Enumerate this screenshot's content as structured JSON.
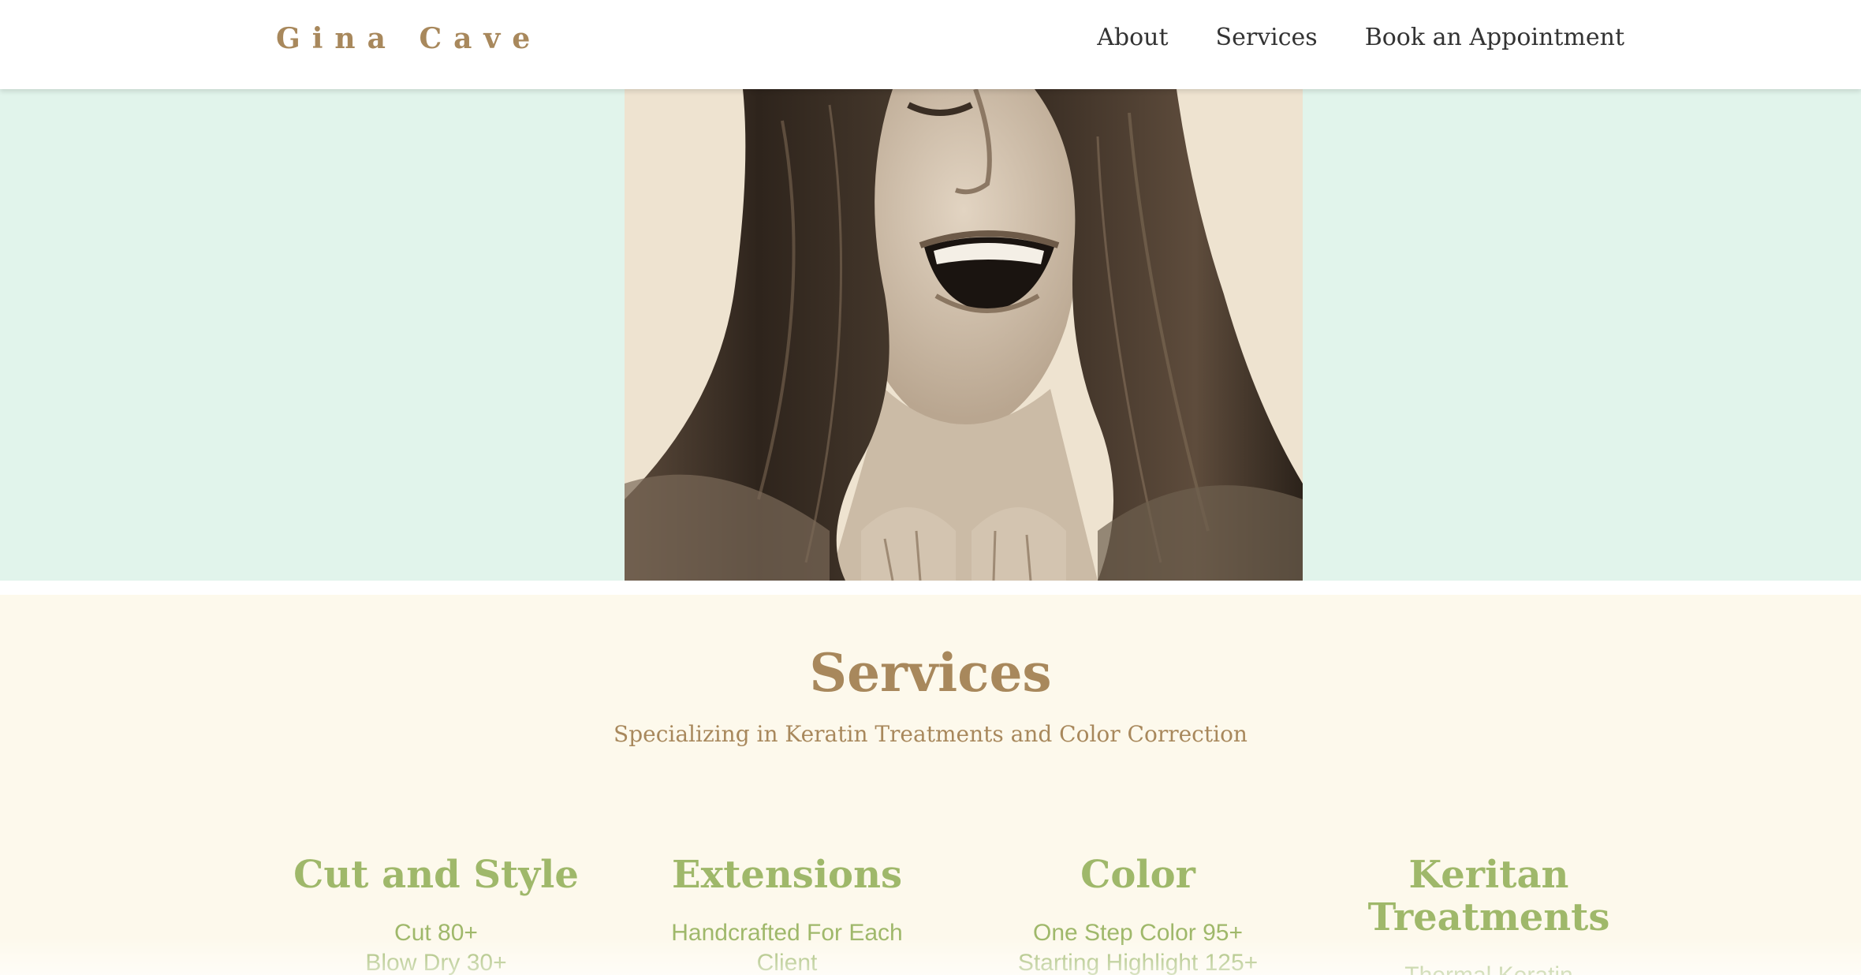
{
  "header": {
    "brand": "Gina Cave",
    "nav": [
      {
        "label": "About"
      },
      {
        "label": "Services"
      },
      {
        "label": "Book an Appointment"
      }
    ]
  },
  "hero": {
    "background_color": "#e1f4eb",
    "image": "laughing-woman-portrait"
  },
  "services": {
    "title": "Services",
    "subtitle": "Specializing in Keratin Treatments and Color Correction",
    "columns": [
      {
        "heading": "Cut and Style",
        "items": [
          "Cut 80+",
          "Blow Dry 30+"
        ]
      },
      {
        "heading": "Extensions",
        "items": [
          "Handcrafted For Each",
          "Client"
        ]
      },
      {
        "heading": "Color",
        "items": [
          "One Step Color 95+",
          "Starting Highlight 125+"
        ]
      },
      {
        "heading": "Keritan Treatments",
        "items": [
          "Thermal Keratin"
        ]
      }
    ]
  },
  "colors": {
    "brand": "#a8885c",
    "accent_green": "#9fb86a",
    "services_bg": "#fdf9ec",
    "hero_bg": "#e1f4eb",
    "nav_text": "#333333"
  }
}
